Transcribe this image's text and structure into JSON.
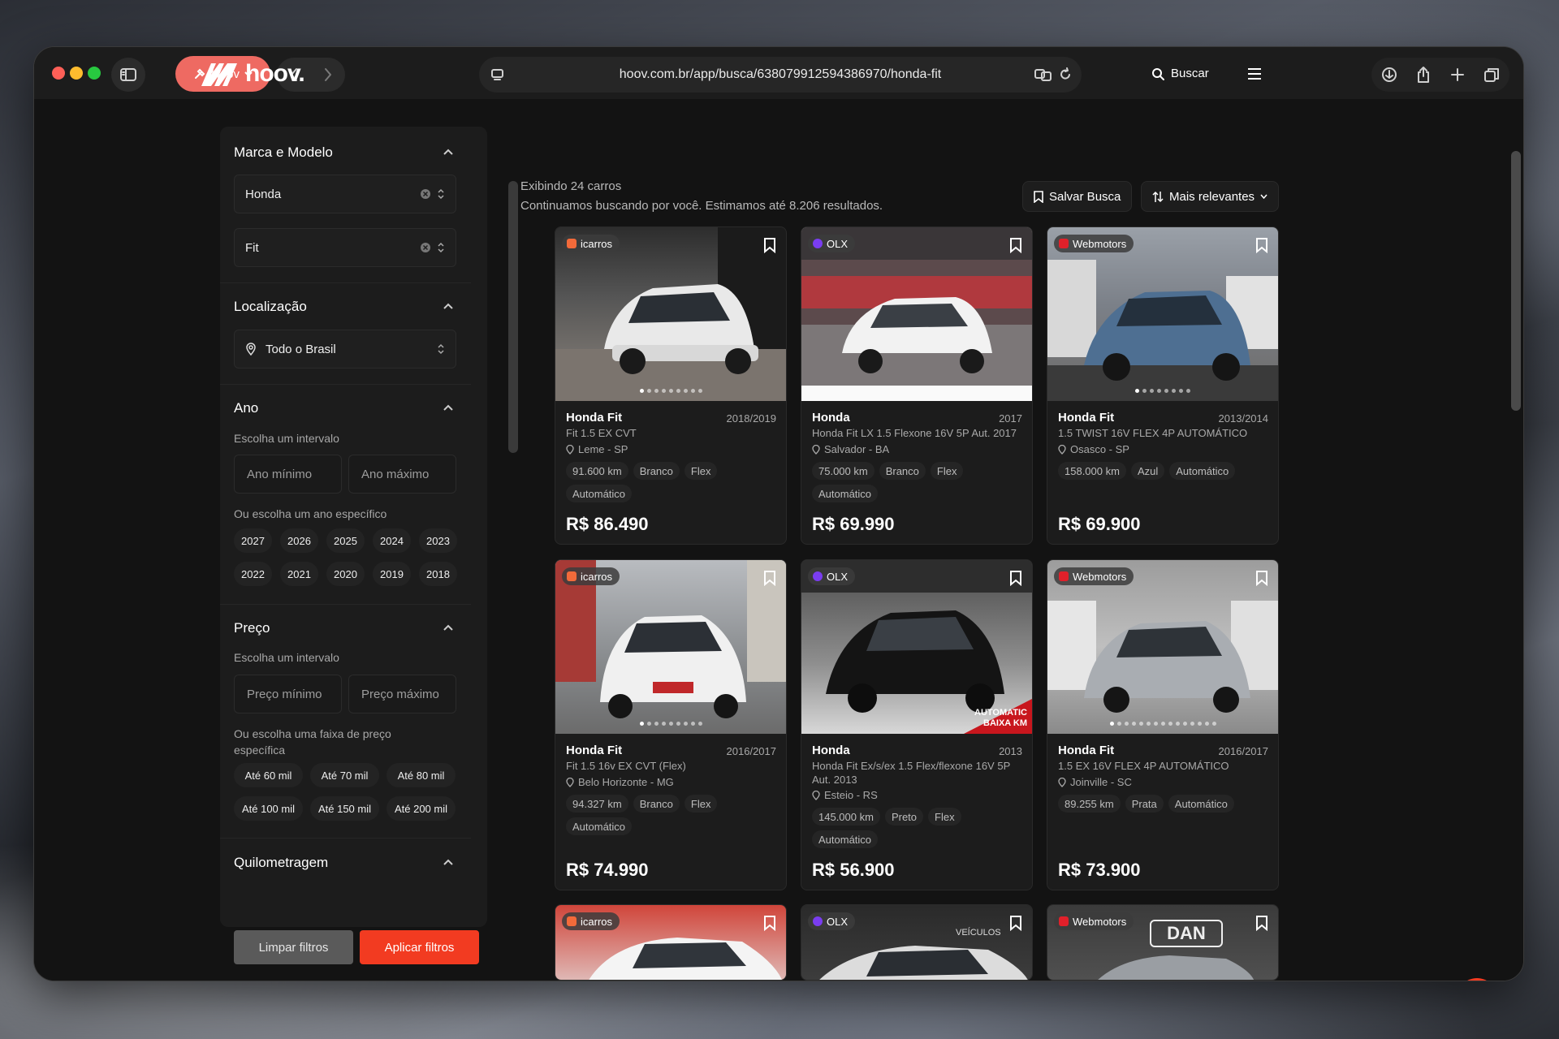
{
  "browser": {
    "tab_label": "Hoov",
    "url": "hoov.com.br/app/busca/638079912594386970/honda-fit"
  },
  "header": {
    "logo_text": "hoov.",
    "search_label": "Buscar"
  },
  "filters": {
    "brand_model": {
      "title": "Marca e Modelo",
      "brand": "Honda",
      "model": "Fit"
    },
    "location": {
      "title": "Localização",
      "value": "Todo o Brasil"
    },
    "year": {
      "title": "Ano",
      "interval_label": "Escolha um intervalo",
      "min_placeholder": "Ano mínimo",
      "max_placeholder": "Ano máximo",
      "specific_label": "Ou escolha um ano específico",
      "options": [
        "2027",
        "2026",
        "2025",
        "2024",
        "2023",
        "2022",
        "2021",
        "2020",
        "2019",
        "2018"
      ]
    },
    "price": {
      "title": "Preço",
      "interval_label": "Escolha um intervalo",
      "min_placeholder": "Preço mínimo",
      "max_placeholder": "Preço máximo",
      "specific_label": "Ou escolha uma faixa de preço específica",
      "options": [
        "Até 60 mil",
        "Até 70 mil",
        "Até 80 mil",
        "Até 100 mil",
        "Até 150 mil",
        "Até 200 mil"
      ]
    },
    "mileage": {
      "title": "Quilometragem"
    },
    "clear_label": "Limpar filtros",
    "apply_label": "Aplicar filtros"
  },
  "results": {
    "count_text": "Exibindo 24 carros",
    "estimate_text": "Continuamos buscando por você. Estimamos até 8.206 resultados.",
    "save_search_label": "Salvar Busca",
    "sort_label": "Mais relevantes"
  },
  "colors": {
    "accent": "#f23b21",
    "icarros": "#f26a3a",
    "olx": "#7a3df0",
    "webmotors": "#e0202a"
  },
  "listings": [
    {
      "source": "icarros",
      "title": "Honda Fit",
      "year": "2018/2019",
      "version": "Fit 1.5 EX CVT",
      "location": "Leme - SP",
      "km": "91.600 km",
      "color": "Branco",
      "fuel": "Flex",
      "transmission": "Automático",
      "price": "R$ 86.490"
    },
    {
      "source": "OLX",
      "title": "Honda",
      "year": "2017",
      "version": "Honda Fit LX 1.5 Flexone 16V 5P Aut. 2017",
      "location": "Salvador - BA",
      "km": "75.000 km",
      "color": "Branco",
      "fuel": "Flex",
      "transmission": "Automático",
      "price": "R$ 69.990"
    },
    {
      "source": "Webmotors",
      "title": "Honda Fit",
      "year": "2013/2014",
      "version": "1.5 TWIST 16V FLEX 4P AUTOMÁTICO",
      "location": "Osasco - SP",
      "km": "158.000 km",
      "color": "Azul",
      "fuel": "",
      "transmission": "Automático",
      "price": "R$ 69.900"
    },
    {
      "source": "icarros",
      "title": "Honda Fit",
      "year": "2016/2017",
      "version": "Fit 1.5 16v EX CVT (Flex)",
      "location": "Belo Horizonte - MG",
      "km": "94.327 km",
      "color": "Branco",
      "fuel": "Flex",
      "transmission": "Automático",
      "price": "R$ 74.990"
    },
    {
      "source": "OLX",
      "title": "Honda",
      "year": "2013",
      "version": "Honda Fit Ex/s/ex 1.5 Flex/flexone 16V 5P Aut. 2013",
      "location": "Esteio - RS",
      "km": "145.000 km",
      "color": "Preto",
      "fuel": "Flex",
      "transmission": "Automático",
      "price": "R$ 56.900",
      "overlay": "AUTOMATIC BAIXA KM"
    },
    {
      "source": "Webmotors",
      "title": "Honda Fit",
      "year": "2016/2017",
      "version": "1.5 EX 16V FLEX 4P AUTOMÁTICO",
      "location": "Joinville - SC",
      "km": "89.255 km",
      "color": "Prata",
      "fuel": "",
      "transmission": "Automático",
      "price": "R$ 73.900"
    },
    {
      "source": "icarros"
    },
    {
      "source": "OLX",
      "photo_text": "VEÍCULOS"
    },
    {
      "source": "Webmotors",
      "photo_text": "DAN"
    }
  ]
}
